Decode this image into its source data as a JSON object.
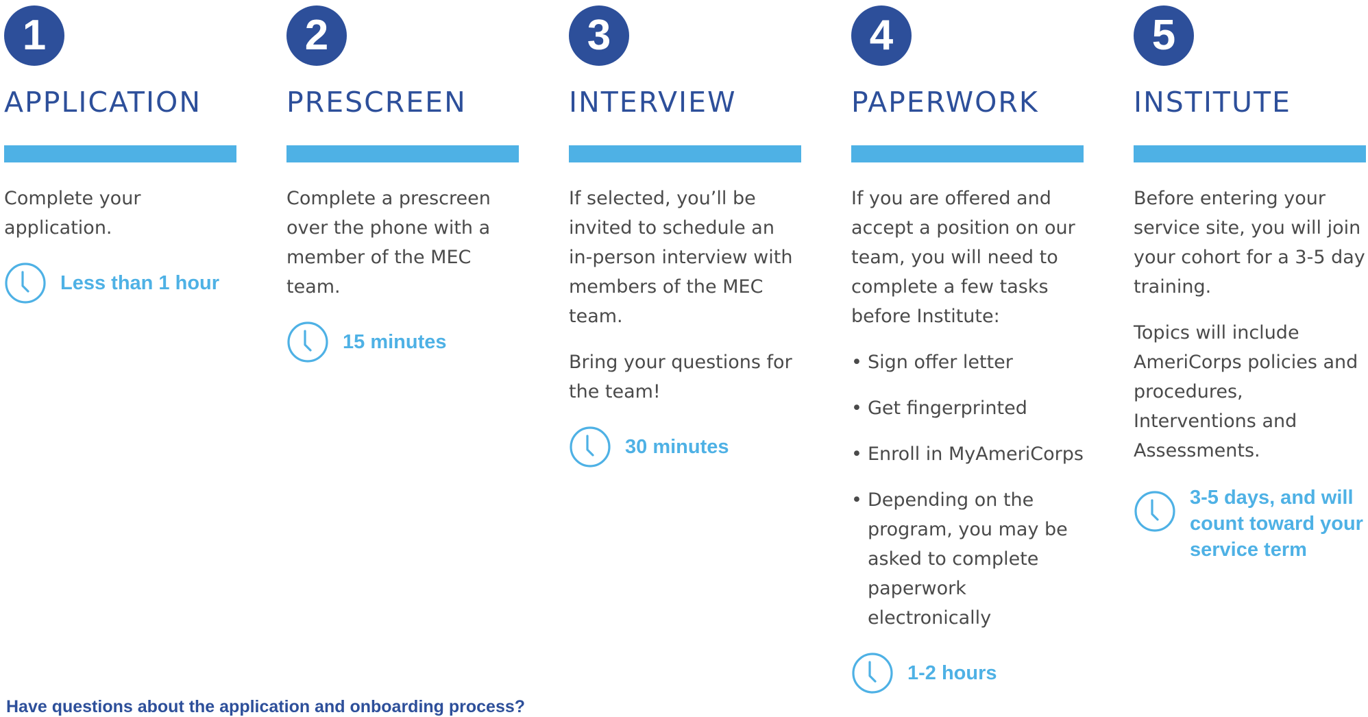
{
  "steps": [
    {
      "number": "1",
      "title": "APPLICATION",
      "paragraphs": [
        "Complete your application."
      ],
      "bullets": [],
      "after_paragraphs": [],
      "duration": "Less than 1 hour"
    },
    {
      "number": "2",
      "title": "PRESCREEN",
      "paragraphs": [
        "Complete a prescreen over the phone with a member of the MEC team."
      ],
      "bullets": [],
      "after_paragraphs": [],
      "duration": "15 minutes"
    },
    {
      "number": "3",
      "title": "INTERVIEW",
      "paragraphs": [
        "If selected, you’ll be invited to schedule an in-person interview with members of the MEC team.",
        "Bring your questions for the team!"
      ],
      "bullets": [],
      "after_paragraphs": [],
      "duration": "30 minutes"
    },
    {
      "number": "4",
      "title": "PAPERWORK",
      "paragraphs": [
        "If you are offered and accept a position on our team, you will need to complete a few tasks before Institute:"
      ],
      "bullets": [
        "Sign offer letter",
        "Get fingerprinted",
        "Enroll in MyAmeriCorps",
        "Depending on the program, you may be asked to complete paperwork electronically"
      ],
      "after_paragraphs": [],
      "duration": "1-2 hours"
    },
    {
      "number": "5",
      "title": "INSTITUTE",
      "paragraphs": [
        "Before entering your service site, you will join your cohort for a 3-5 day training.",
        "Topics will include AmeriCorps policies and procedures, Interventions and Assessments."
      ],
      "bullets": [],
      "after_paragraphs": [],
      "duration": "3-5 days, and will count toward your service term"
    }
  ],
  "footer": {
    "question": "Have questions about the application and onboarding process?"
  },
  "colors": {
    "navy": "#2d4f9a",
    "accent_blue": "#4eb1e5",
    "body_text": "#4a4a4a"
  },
  "icons": {
    "duration_icon": "clock-icon"
  }
}
